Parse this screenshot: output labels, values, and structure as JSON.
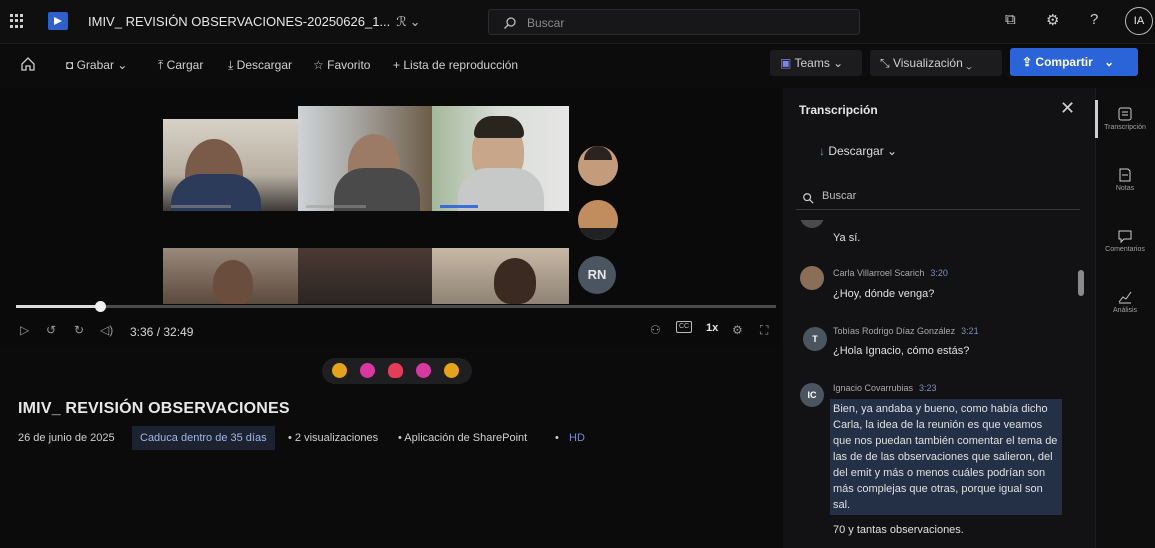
{
  "topbar": {
    "filename": "IMIV_ REVISIÓN OBSERVACIONES-20250626_1...",
    "search_placeholder": "Buscar",
    "avatar_initials": "IA"
  },
  "toolbar": {
    "record": "Grabar",
    "upload": "Cargar",
    "download": "Descargar",
    "favorite": "Favorito",
    "playlist": "Lista de reproducción",
    "teams": "Teams",
    "view": "Visualización",
    "share": "Compartir"
  },
  "video": {
    "avatar_initials": "RN",
    "time": "3:36 / 32:49",
    "speed": "1x",
    "progress_fraction": 0.11,
    "cc": "CC"
  },
  "info": {
    "title": "IMIV_ REVISIÓN OBSERVACIONES",
    "date": "26 de junio de 2025",
    "expires": "Caduca dentro de 35 días",
    "views": "• 2 visualizaciones",
    "app": "• Aplicación de SharePoint",
    "quality_sep": "•",
    "quality": "HD"
  },
  "transcript": {
    "title": "Transcripción",
    "download": "Descargar",
    "search_placeholder": "Buscar",
    "entries": [
      {
        "speaker": "",
        "time": "",
        "initials": "",
        "text": "Ya sí."
      },
      {
        "speaker": "Carla Villarroel Scarich",
        "time": "3:20",
        "initials": "",
        "text": "¿Hoy, dónde venga?"
      },
      {
        "speaker": "Tobías Rodrigo Díaz González",
        "time": "3:21",
        "initials": "T",
        "text": "¿Hola Ignacio, cómo estás?"
      },
      {
        "speaker": "Ignacio Covarrubias",
        "time": "3:23",
        "initials": "IC",
        "text": "Bien, ya andaba y bueno, como había dicho Carla, la idea de la reunión es que veamos que nos puedan también comentar el tema de las de de las observaciones que salieron, del del emit y más o menos cuáles podrían son más complejas que otras, porque igual son sal."
      },
      {
        "speaker": "",
        "time": "",
        "initials": "",
        "text": "70 y tantas observaciones."
      }
    ]
  },
  "rail": {
    "transcript": "Transcripción",
    "notes": "Notas",
    "comments": "Comentarios",
    "analytics": "Análisis"
  },
  "colors": {
    "accent": "#2b63d9",
    "background": "#0b0b0c",
    "panel": "#121214",
    "highlight": "#243045"
  }
}
